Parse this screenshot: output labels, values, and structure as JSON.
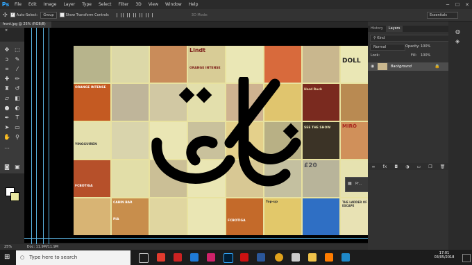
{
  "app": {
    "logo": "Ps",
    "accent": "#31a8ff"
  },
  "menu": [
    "File",
    "Edit",
    "Image",
    "Layer",
    "Type",
    "Select",
    "Filter",
    "3D",
    "View",
    "Window",
    "Help"
  ],
  "window_controls": [
    "─",
    "☐",
    "✕"
  ],
  "options_bar": {
    "auto_select_label": "Auto-Select:",
    "auto_select_value": "Group",
    "show_transform_label": "Show Transform Controls",
    "mode_3d_label": "3D Mode:",
    "workspace": "Essentials"
  },
  "document_tab": {
    "label": "front.jpg @ 25% (RGB/8)",
    "close": "×"
  },
  "panels": {
    "tabs": [
      "History",
      "Layers"
    ],
    "active_tab": "Layers",
    "kind_placeholder": "Kind",
    "blend_mode": "Normal",
    "opacity_label": "Opacity:",
    "opacity_value": "100%",
    "lock_label": "Lock:",
    "fill_label": "Fill:",
    "fill_value": "100%",
    "layer_name": "Background"
  },
  "collage_text": {
    "t1": "ORANGE INTENSE",
    "t2": "ORANGE INTENSE",
    "t3": "DOLL",
    "t4": "Hard Rock",
    "t5": "SEE THE SHOW",
    "t6": "MIRÓ",
    "t7": "YINGGUIREN",
    "t8": "FCBOTIGA",
    "t9": "FCBOTIGA",
    "t10": "CABIN BAR",
    "t11": "PIA",
    "t12": "£20",
    "t13": "Lindt",
    "t14": "THE LADDER OF ESCAPE",
    "t15": "Top-up"
  },
  "float_window": {
    "label": "Pr..."
  },
  "status": {
    "zoom": "25%",
    "doc": "Doc: 11.9M/11.9M"
  },
  "taskbar": {
    "search_placeholder": "Type here to search",
    "time": "17:01",
    "date": "03/05/2018"
  },
  "colors": {
    "bg": "#282828",
    "canvas": "#000000",
    "guide": "#5ab3e0",
    "brand_blue": "#31a8ff"
  }
}
